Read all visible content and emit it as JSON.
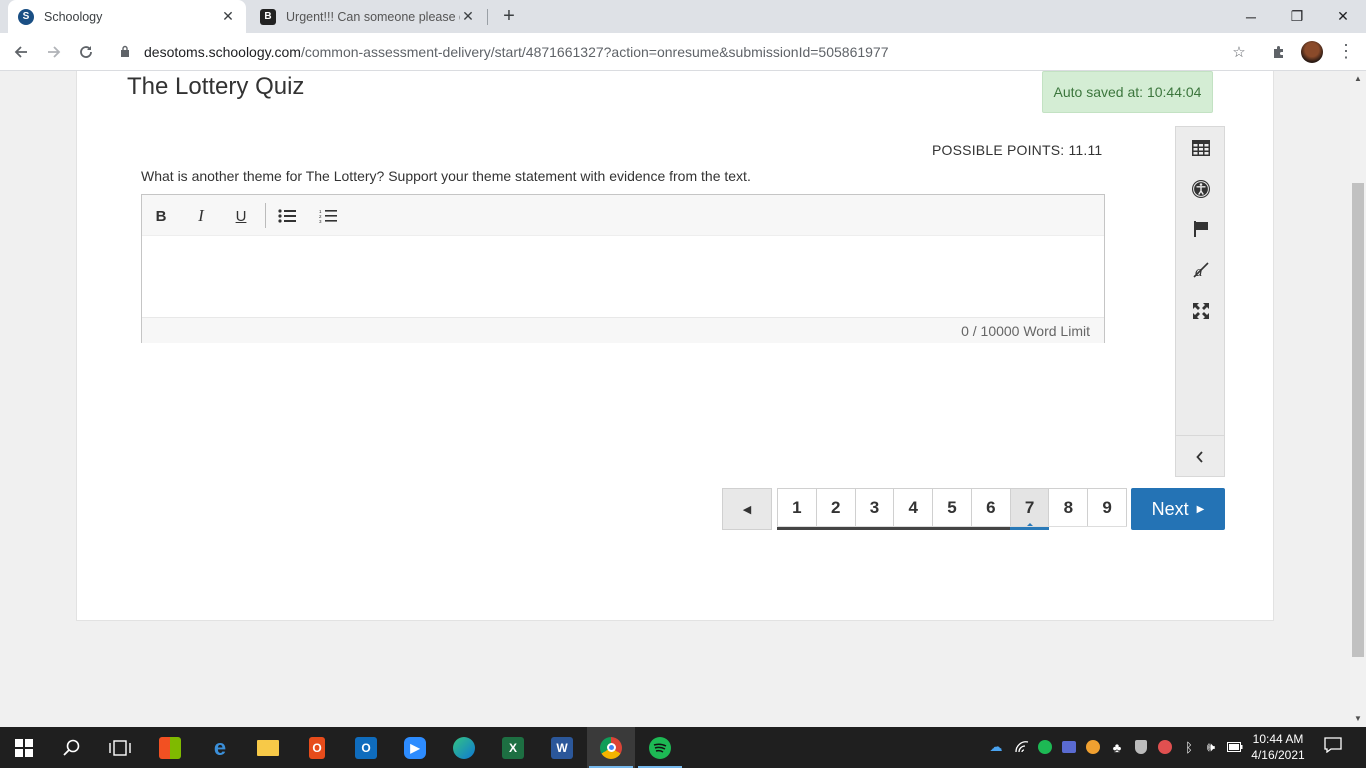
{
  "browser": {
    "tabs": [
      {
        "title": "Schoology",
        "favicon": "schoology-icon",
        "active": true
      },
      {
        "title": "Urgent!!! Can someone please gi",
        "favicon": "brainly-icon",
        "active": false
      }
    ],
    "url_host": "desotoms.schoology.com",
    "url_path": "/common-assessment-delivery/start/4871661327?action=onresume&submissionId=505861977"
  },
  "quiz": {
    "title": "The Lottery Quiz",
    "autosave": "Auto saved at: 10:44:04",
    "points": "POSSIBLE POINTS: 11.11",
    "question": "What is another theme for The Lottery?  Support your theme statement with evidence from the text.",
    "editor": {
      "toolbar": [
        {
          "name": "bold-icon",
          "glyph": "B"
        },
        {
          "name": "italic-icon",
          "glyph": "I"
        },
        {
          "name": "underline-icon",
          "glyph": "U"
        },
        {
          "name": "bulleted-list-icon",
          "glyph": "•"
        },
        {
          "name": "numbered-list-icon",
          "glyph": "1"
        }
      ],
      "content": "",
      "word_count": "0",
      "word_limit": "/ 10000 Word Limit"
    },
    "side_tools": [
      "calculator-icon",
      "accessibility-icon",
      "flag-icon",
      "eliminate-icon",
      "fullscreen-icon"
    ],
    "pagination": {
      "pages": [
        "1",
        "2",
        "3",
        "4",
        "5",
        "6",
        "7",
        "8",
        "9"
      ],
      "current": "7",
      "next_label": "Next"
    }
  },
  "taskbar": {
    "apps": [
      "start",
      "search",
      "task-view",
      "microsoft-store",
      "edge-legacy",
      "file-explorer",
      "office",
      "outlook",
      "zoom",
      "edge",
      "excel",
      "word",
      "chrome",
      "spotify"
    ],
    "time": "10:44 AM",
    "date": "4/16/2021"
  }
}
